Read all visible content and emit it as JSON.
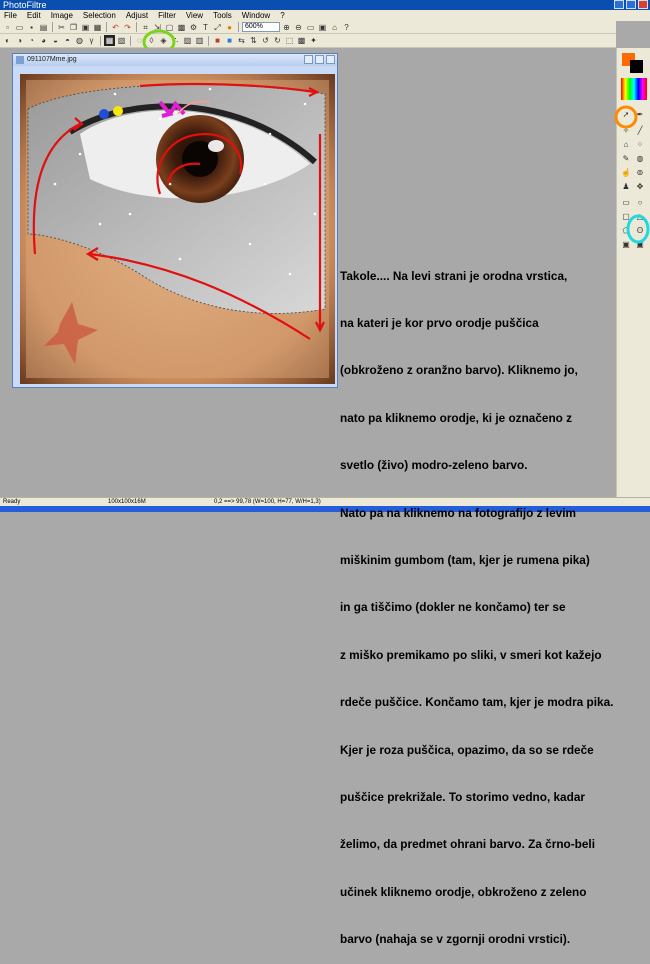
{
  "app": {
    "title": "PhotoFiltre"
  },
  "menu": [
    "File",
    "Edit",
    "Image",
    "Selection",
    "Adjust",
    "Filter",
    "View",
    "Tools",
    "Window",
    "?"
  ],
  "toolbar": {
    "zoom_value": "600%"
  },
  "document": {
    "title": "091107Mme.jpg"
  },
  "statusbar": {
    "left": "Ready",
    "size": "100x100x16M",
    "coords": "0,2 ==> 99,78 (W=100, H=77, W/H=1,3)"
  },
  "colors": {
    "foreground": "#ff6a00",
    "background": "#000000",
    "annotation_red": "#e01010",
    "highlight_green": "#7bd31c",
    "highlight_orange": "#ff8a00",
    "highlight_cyan": "#20d8e0",
    "marker_pink": "#e020d0",
    "marker_yellow": "#f6e80a",
    "marker_blue": "#1f4fd8"
  },
  "annotation": {
    "lines": [
      "Takole.... Na levi strani je orodna vrstica,",
      "na kateri je kor prvo orodje puščica",
      "(obkroženo z oranžno barvo). Kliknemo jo,",
      "nato pa kliknemo orodje, ki je označeno z",
      "svetlo (živo) modro-zeleno barvo.",
      "Nato pa na kliknemo na fotografijo z levim",
      "miškinim gumbom (tam, kjer je rumena pika)",
      "in ga tiščimo (dokler ne končamo) ter se",
      "z miško premikamo po sliki, v smeri kot kažejo",
      "rdeče puščice. Končamo tam, kjer je modra pika.",
      "Kjer je roza puščica, opazimo, da so se rdeče",
      "puščice prekrižale. To storimo vedno, kadar",
      "želimo, da predmet ohrani barvo. Za črno-beli",
      "učinek kliknemo orodje, obkroženo z zeleno",
      "barvo (nahaja se v zgornji orodni vrstici)."
    ]
  }
}
